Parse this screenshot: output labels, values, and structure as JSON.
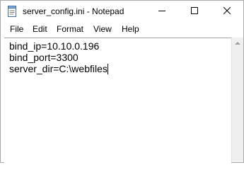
{
  "window": {
    "title": "server_config.ini - Notepad",
    "app_icon": "notepad-icon"
  },
  "caption_buttons": {
    "minimize_icon": "minimize-icon",
    "maximize_icon": "maximize-icon",
    "close_icon": "close-icon"
  },
  "menu": {
    "items": [
      {
        "label": "File"
      },
      {
        "label": "Edit"
      },
      {
        "label": "Format"
      },
      {
        "label": "View"
      },
      {
        "label": "Help"
      }
    ]
  },
  "editor": {
    "lines": [
      "bind_ip=10.10.0.196",
      "bind_port=3300",
      "server_dir=C:\\webfiles"
    ]
  },
  "colors": {
    "text": "#000000",
    "background": "#ffffff",
    "scrollbar": "#f0f0f0"
  }
}
